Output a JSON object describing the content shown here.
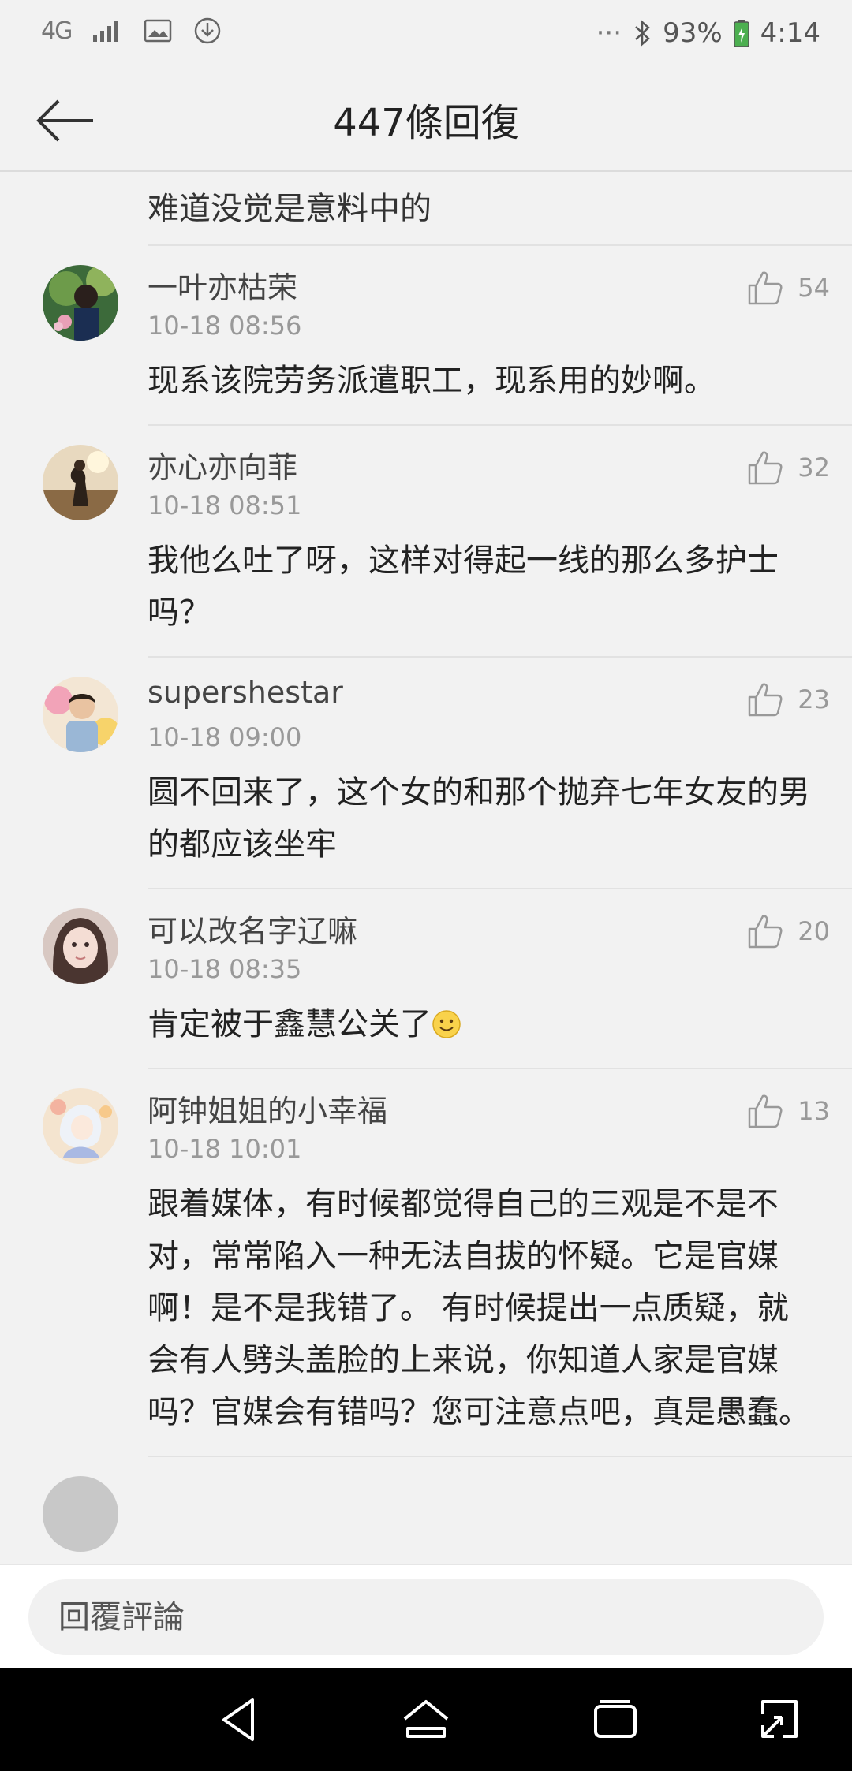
{
  "status_bar": {
    "network": "4G",
    "icons": [
      "signal-icon",
      "image-icon",
      "download-icon",
      "more-icon",
      "bluetooth-icon",
      "battery-icon"
    ],
    "more": "···",
    "battery": "93%",
    "time": "4:14"
  },
  "header": {
    "title": "447條回復",
    "back_icon": "arrow-left-icon"
  },
  "comments_partial_top": {
    "text": "难道没觉是意料中的"
  },
  "comments": [
    {
      "user": "一叶亦枯荣",
      "time": "10-18 08:56",
      "likes": "54",
      "text": "现系该院劳务派遣职工，现系用的妙啊。"
    },
    {
      "user": "亦心亦向菲",
      "time": "10-18 08:51",
      "likes": "32",
      "text": "我他么吐了呀，这样对得起一线的那么多护士吗？"
    },
    {
      "user": "supershestar",
      "time": "10-18 09:00",
      "likes": "23",
      "text": "圆不回来了，这个女的和那个抛弃七年女友的男的都应该坐牢"
    },
    {
      "user": "可以改名字辽嘛",
      "time": "10-18 08:35",
      "likes": "20",
      "text": "肯定被于鑫慧公关了"
    },
    {
      "user": "阿钟姐姐的小幸福",
      "time": "10-18 10:01",
      "likes": "13",
      "text": "跟着媒体，有时候都觉得自己的三观是不是不对，常常陷入一种无法自拔的怀疑。它是官媒啊！是不是我错了。 有时候提出一点质疑，就会有人劈头盖脸的上来说，你知道人家是官媒吗？官媒会有错吗？您可注意点吧，真是愚蠢。"
    }
  ],
  "reply_bar": {
    "placeholder": "回覆評論"
  },
  "nav_bar": {
    "icons": [
      "back-triangle-icon",
      "home-icon",
      "recents-icon",
      "screenshot-expand-icon"
    ]
  },
  "colors": {
    "background": "#f2f2f2",
    "divider": "#e2e2e2",
    "navbar": "#000000",
    "battery_charging": "#4caf50"
  }
}
